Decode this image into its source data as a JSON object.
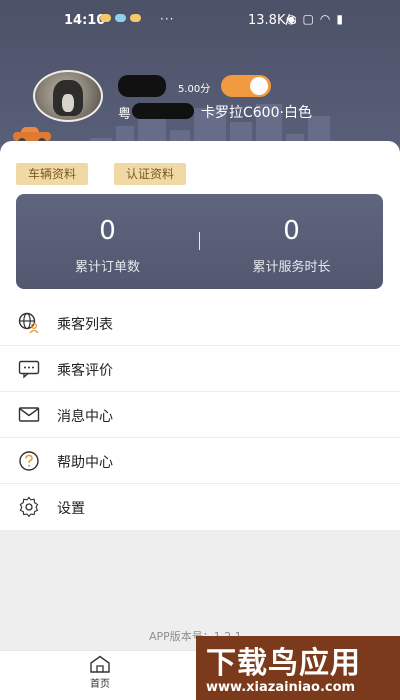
{
  "status_bar": {
    "time": "14:10",
    "network_speed": "13.8K/s"
  },
  "profile": {
    "rating": "5.00分",
    "plate_first_char": "粤",
    "car_info": "卡罗拉C600·白色",
    "online_toggle": true
  },
  "buttons": {
    "vehicle_info": "车辆资料",
    "cert_info": "认证资料"
  },
  "stats": {
    "orders_value": "0",
    "orders_label": "累计订单数",
    "service_value": "0",
    "service_label": "累计服务时长"
  },
  "menu": {
    "items": [
      {
        "label": "乘客列表",
        "icon": "passenger-list-icon"
      },
      {
        "label": "乘客评价",
        "icon": "comment-icon"
      },
      {
        "label": "消息中心",
        "icon": "mail-icon"
      },
      {
        "label": "帮助中心",
        "icon": "help-icon"
      },
      {
        "label": "设置",
        "icon": "settings-icon"
      }
    ]
  },
  "footer": {
    "version": "APP版本号：1.2.1"
  },
  "tabs": {
    "home": "首页"
  },
  "watermark": {
    "main": "下载鸟应用",
    "url": "www.xiazainiao.com"
  },
  "colors": {
    "header": "#4c5167",
    "accent_orange": "#f29a3f",
    "tag_bg": "#f1d9a6",
    "stats_bg": "#5a6078"
  }
}
